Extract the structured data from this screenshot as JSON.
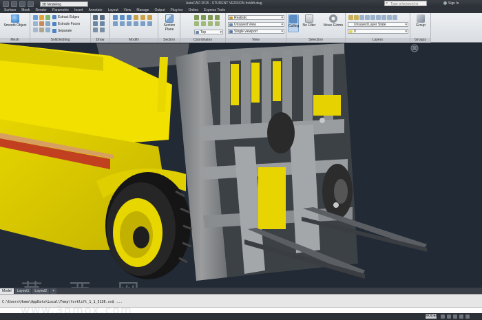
{
  "titlebar": {
    "workspace": "3D Modeling",
    "title": "AutoCAD 2015 - STUDENT VERSION   forklift.dwg",
    "search_placeholder": "Type a keyword or phrase",
    "signin": "Sign In"
  },
  "ribbon_tabs": [
    "Surface",
    "Mesh",
    "Render",
    "Parametric",
    "Insert",
    "Annotate",
    "Layout",
    "View",
    "Manage",
    "Output",
    "Plug-ins",
    "Online",
    "Express Tools"
  ],
  "ribbon": {
    "panels": {
      "mesh": "Mesh",
      "solid_editing": "Solid Editing",
      "draw": "Draw",
      "modify": "Modify",
      "section": "Section",
      "coordinates": "Coordinates",
      "view": "View",
      "selection": "Selection",
      "layers": "Layers",
      "groups": "Groups"
    },
    "buttons": {
      "smooth_object": "Smooth Object",
      "extract_edges": "Extract Edges",
      "extrude_faces": "Extrude Faces",
      "separate": "Separate",
      "section_plane": "Section Plane",
      "culling": "Culling",
      "no_filter": "No Filter",
      "move_gizmo": "Move Gizmo",
      "group": "Group"
    },
    "dropdowns": {
      "visual_style": "Realistic",
      "saved_view": "Unsaved View",
      "ucs_world": "Top",
      "viewport_config": "Single viewport",
      "layer_state": "Unsaved Layer State",
      "layer_current": "0"
    }
  },
  "layout_tabs": [
    "Model",
    "Layout1",
    "Layout2",
    "+"
  ],
  "command_line": "C:\\Users\\Home\\AppData\\Local\\Temp\\forklift_1_1_5136.sv$ ...",
  "watermark": "草 西 网",
  "url_watermark": "www.3dmox.com",
  "status": {
    "model": "MODEL"
  },
  "colors": {
    "body_yellow": "#f4e000",
    "frame_gray": "#8e9092",
    "viewport_bg": "#222a35",
    "tire_dark": "#1c1c1c"
  }
}
